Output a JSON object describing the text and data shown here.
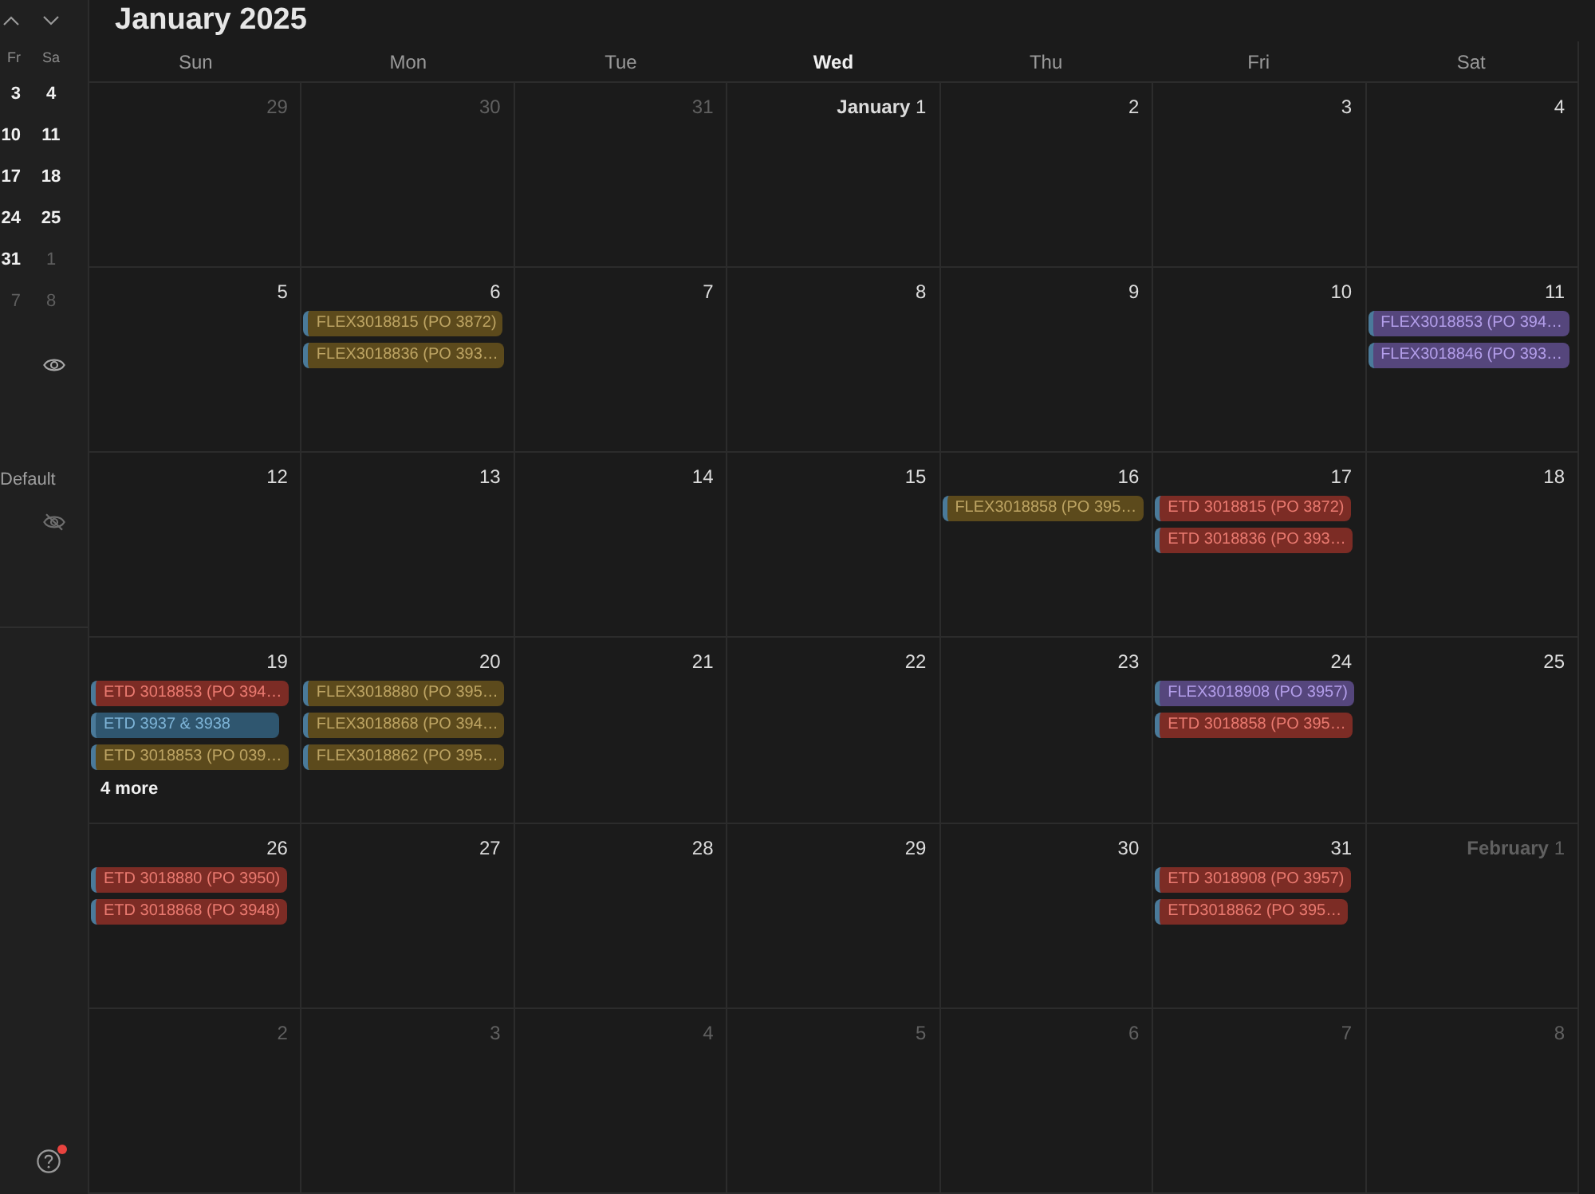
{
  "sidebar": {
    "mini_calendar": {
      "weekdays": [
        "Fr",
        "Sa"
      ],
      "weeks": [
        [
          {
            "day": "3",
            "in_month": true
          },
          {
            "day": "4",
            "in_month": true
          }
        ],
        [
          {
            "day": "10",
            "in_month": true
          },
          {
            "day": "11",
            "in_month": true
          }
        ],
        [
          {
            "day": "17",
            "in_month": true
          },
          {
            "day": "18",
            "in_month": true
          }
        ],
        [
          {
            "day": "24",
            "in_month": true
          },
          {
            "day": "25",
            "in_month": true
          }
        ],
        [
          {
            "day": "31",
            "in_month": true
          },
          {
            "day": "1",
            "in_month": false
          }
        ],
        [
          {
            "day": "7",
            "in_month": false
          },
          {
            "day": "8",
            "in_month": false
          }
        ]
      ]
    },
    "calendar_list": [
      {
        "kind": "calendar",
        "visible": true
      },
      {
        "kind": "heading",
        "label": "Default"
      },
      {
        "kind": "calendar",
        "visible": false
      }
    ],
    "help": {
      "notification": true
    }
  },
  "calendar": {
    "title": "January 2025",
    "weekdays": [
      {
        "label": "Sun",
        "current": false
      },
      {
        "label": "Mon",
        "current": false
      },
      {
        "label": "Tue",
        "current": false
      },
      {
        "label": "Wed",
        "current": true
      },
      {
        "label": "Thu",
        "current": false
      },
      {
        "label": "Fri",
        "current": false
      },
      {
        "label": "Sat",
        "current": false
      }
    ],
    "weeks": [
      [
        {
          "label": "29",
          "in_month": false
        },
        {
          "label": "30",
          "in_month": false
        },
        {
          "label": "31",
          "in_month": false
        },
        {
          "label": "**January** 1",
          "in_month": true
        },
        {
          "label": "2",
          "in_month": true
        },
        {
          "label": "3",
          "in_month": true
        },
        {
          "label": "4",
          "in_month": true
        }
      ],
      [
        {
          "label": "5",
          "in_month": true
        },
        {
          "label": "6",
          "in_month": true,
          "events": [
            {
              "title": "FLEX3018815 (PO 3872)",
              "color": "#5c4a1c"
            },
            {
              "title": "FLEX3018836 (PO 393…",
              "color": "#5c4a1c"
            }
          ]
        },
        {
          "label": "7",
          "in_month": true
        },
        {
          "label": "8",
          "in_month": true
        },
        {
          "label": "9",
          "in_month": true
        },
        {
          "label": "10",
          "in_month": true
        },
        {
          "label": "11",
          "in_month": true,
          "events": [
            {
              "title": "FLEX3018853 (PO 394…",
              "color": "#55467c"
            },
            {
              "title": "FLEX3018846 (PO 393…",
              "color": "#55467c"
            }
          ]
        }
      ],
      [
        {
          "label": "12",
          "in_month": true
        },
        {
          "label": "13",
          "in_month": true
        },
        {
          "label": "14",
          "in_month": true
        },
        {
          "label": "15",
          "in_month": true
        },
        {
          "label": "16",
          "in_month": true,
          "events": [
            {
              "title": "FLEX3018858 (PO 395…",
              "color": "#5c4a1c"
            }
          ]
        },
        {
          "label": "17",
          "in_month": true,
          "events": [
            {
              "title": "ETD 3018815 (PO 3872)",
              "color": "#7c2c25"
            },
            {
              "title": "ETD 3018836 (PO 393…",
              "color": "#7c2c25"
            }
          ]
        },
        {
          "label": "18",
          "in_month": true
        }
      ],
      [
        {
          "label": "19",
          "in_month": true,
          "events": [
            {
              "title": "ETD 3018853 (PO 394…",
              "color": "#7c2c25"
            },
            {
              "title": "ETD 3937 & 3938",
              "color": "#2f566f"
            },
            {
              "title": "ETD 3018853 (PO 039…",
              "color": "#5c4a1c"
            }
          ],
          "more": "4 more"
        },
        {
          "label": "20",
          "in_month": true,
          "events": [
            {
              "title": "FLEX3018880 (PO 395…",
              "color": "#5c4a1c"
            },
            {
              "title": "FLEX3018868 (PO 394…",
              "color": "#5c4a1c"
            },
            {
              "title": "FLEX3018862 (PO 395…",
              "color": "#5c4a1c"
            }
          ]
        },
        {
          "label": "21",
          "in_month": true
        },
        {
          "label": "22",
          "in_month": true
        },
        {
          "label": "23",
          "in_month": true
        },
        {
          "label": "24",
          "in_month": true,
          "events": [
            {
              "title": "FLEX3018908 (PO 3957)",
              "color": "#55467c"
            },
            {
              "title": "ETD 3018858 (PO 395…",
              "color": "#7c2c25"
            }
          ]
        },
        {
          "label": "25",
          "in_month": true
        }
      ],
      [
        {
          "label": "26",
          "in_month": true,
          "events": [
            {
              "title": "ETD 3018880 (PO 3950)",
              "color": "#7c2c25"
            },
            {
              "title": "ETD 3018868 (PO 3948)",
              "color": "#7c2c25"
            }
          ]
        },
        {
          "label": "27",
          "in_month": true
        },
        {
          "label": "28",
          "in_month": true
        },
        {
          "label": "29",
          "in_month": true
        },
        {
          "label": "30",
          "in_month": true
        },
        {
          "label": "31",
          "in_month": true,
          "events": [
            {
              "title": "ETD 3018908 (PO 3957)",
              "color": "#7c2c25"
            },
            {
              "title": "ETD3018862 (PO 395…",
              "color": "#7c2c25"
            }
          ]
        },
        {
          "label": "**February** 1",
          "in_month": false
        }
      ],
      [
        {
          "label": "2",
          "in_month": false
        },
        {
          "label": "3",
          "in_month": false
        },
        {
          "label": "4",
          "in_month": false
        },
        {
          "label": "5",
          "in_month": false
        },
        {
          "label": "6",
          "in_month": false
        },
        {
          "label": "7",
          "in_month": false
        },
        {
          "label": "8",
          "in_month": false
        }
      ]
    ]
  }
}
